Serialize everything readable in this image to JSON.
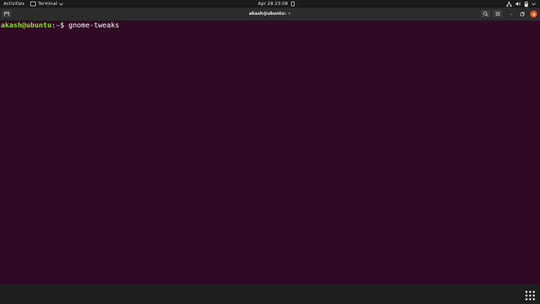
{
  "topbar": {
    "activities": "Activities",
    "app_menu_label": "Terminal",
    "clock": "Apr 28  23:08",
    "icons": [
      "terminal-icon",
      "chevron-down-icon",
      "notification-icon",
      "network-icon",
      "volume-icon",
      "battery-icon",
      "chevron-down-icon"
    ]
  },
  "window": {
    "title": "akash@ubuntu: ~",
    "buttons": {
      "new_tab": "new-tab-icon",
      "search": "search-icon",
      "menu": "hamburger-menu-icon",
      "minimize": "–",
      "maximize": "⧉",
      "close": "close-icon"
    }
  },
  "terminal": {
    "user_host": "akash@ubuntu",
    "colon": ":",
    "path": "~",
    "dollar": "$",
    "command": "gnome-tweaks"
  },
  "dock": {
    "show_apps_icon": "show-applications-grid-icon"
  },
  "colors": {
    "terminal_bg": "#300a24",
    "prompt_user": "#8ae234",
    "prompt_path": "#729fcf",
    "close_button": "#e95420"
  }
}
